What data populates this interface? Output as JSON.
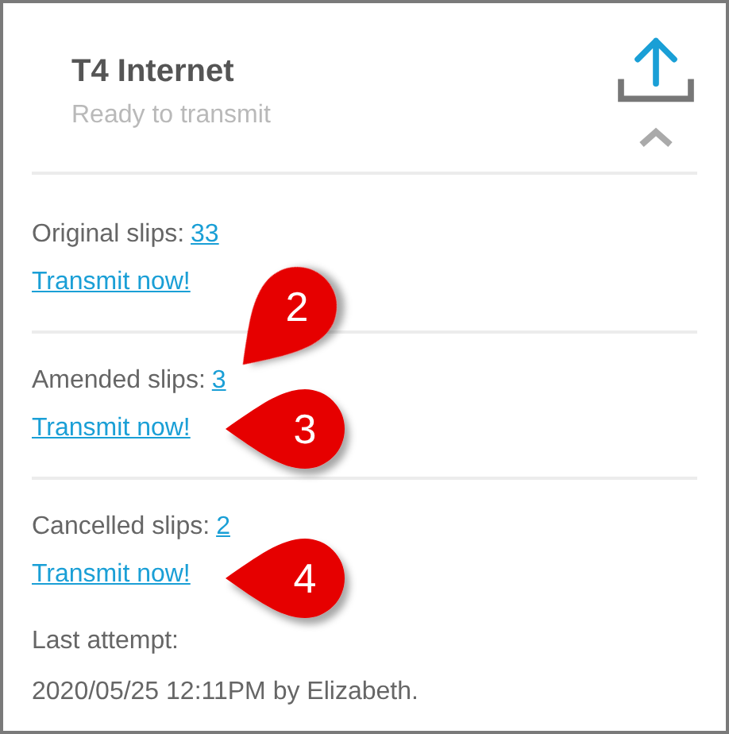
{
  "header": {
    "title": "T4 Internet",
    "status": "Ready to transmit",
    "expanded": true
  },
  "sections": [
    {
      "label": "Original slips:",
      "count": "33",
      "link": "Transmit now!"
    },
    {
      "label": "Amended slips:",
      "count": "3",
      "link": "Transmit now!"
    },
    {
      "label": "Cancelled slips:",
      "count": "2",
      "link": "Transmit now!"
    }
  ],
  "last_attempt": {
    "label": "Last attempt:",
    "value": "2020/05/25 12:11PM by Elizabeth."
  },
  "callouts": [
    {
      "number": "2",
      "kind": "down-left"
    },
    {
      "number": "3",
      "kind": "left"
    },
    {
      "number": "4",
      "kind": "left"
    }
  ]
}
